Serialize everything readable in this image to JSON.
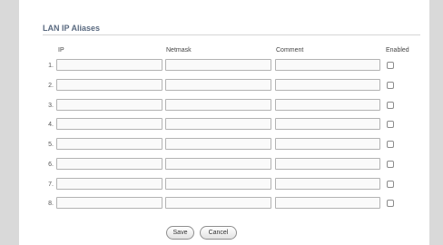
{
  "section": {
    "title": "LAN IP Aliases"
  },
  "columns": {
    "ip": "IP",
    "netmask": "Netmask",
    "comment": "Comment",
    "enabled": "Enabled"
  },
  "rows": [
    {
      "num": "1.",
      "ip": "",
      "netmask": "",
      "comment": "",
      "enabled": false
    },
    {
      "num": "2.",
      "ip": "",
      "netmask": "",
      "comment": "",
      "enabled": false
    },
    {
      "num": "3.",
      "ip": "",
      "netmask": "",
      "comment": "",
      "enabled": false
    },
    {
      "num": "4.",
      "ip": "",
      "netmask": "",
      "comment": "",
      "enabled": false
    },
    {
      "num": "5.",
      "ip": "",
      "netmask": "",
      "comment": "",
      "enabled": false
    },
    {
      "num": "6.",
      "ip": "",
      "netmask": "",
      "comment": "",
      "enabled": false
    },
    {
      "num": "7.",
      "ip": "",
      "netmask": "",
      "comment": "",
      "enabled": false
    },
    {
      "num": "8.",
      "ip": "",
      "netmask": "",
      "comment": "",
      "enabled": false
    }
  ],
  "buttons": {
    "save": "Save",
    "cancel": "Cancel"
  }
}
